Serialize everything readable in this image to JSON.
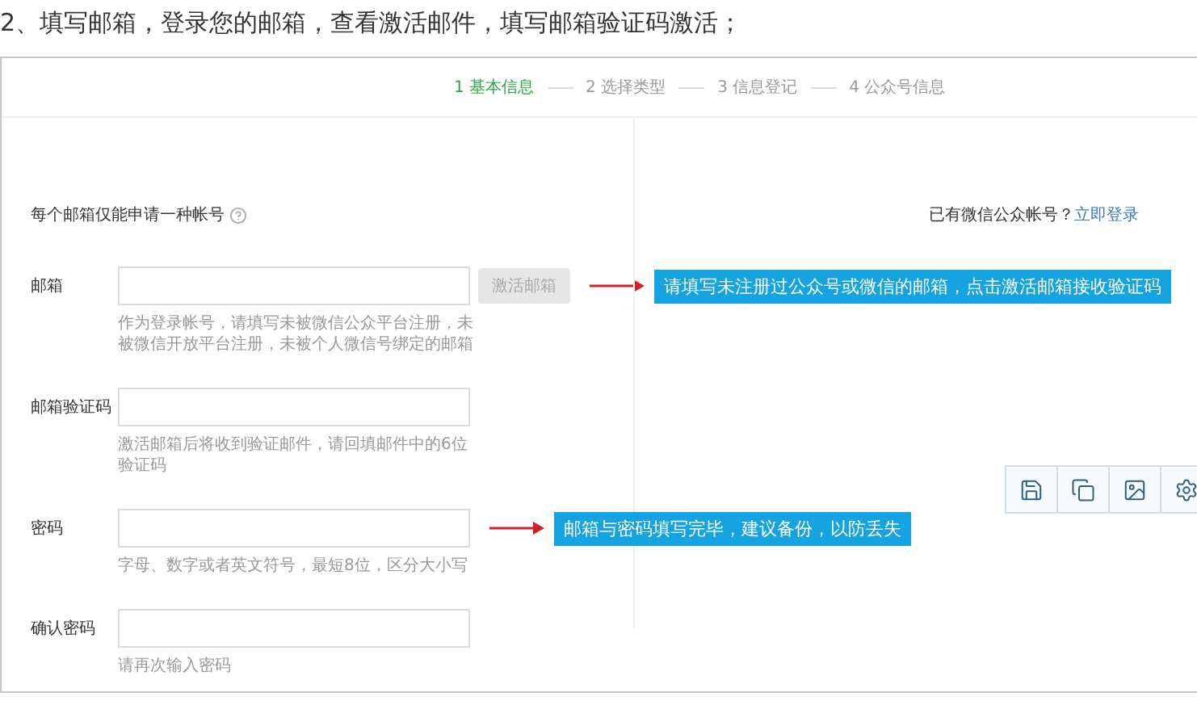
{
  "instruction": "2、填写邮箱，登录您的邮箱，查看激活邮件，填写邮箱验证码激活；",
  "steps": [
    {
      "label": "1 基本信息",
      "selected": true
    },
    {
      "label": "2 选择类型",
      "selected": false
    },
    {
      "label": "3 信息登记",
      "selected": false
    },
    {
      "label": "4 公众号信息",
      "selected": false
    }
  ],
  "notice": "每个邮箱仅能申请一种帐号",
  "login_prompt": {
    "text": "已有微信公众帐号？",
    "link": "立即登录"
  },
  "fields": [
    {
      "label": "邮箱",
      "hint": "作为登录帐号，请填写未被微信公众平台注册，未被微信开放平台注册，未被个人微信号绑定的邮箱",
      "button": {
        "label": "激活邮箱",
        "disabled": true
      },
      "callout": "请填写未注册过公众号或微信的邮箱，点击激活邮箱接收验证码"
    },
    {
      "label": "邮箱验证码",
      "hint": "激活邮箱后将收到验证邮件，请回填邮件中的6位验证码"
    },
    {
      "label": "密码",
      "hint": "字母、数字或者英文符号，最短8位，区分大小写",
      "callout": "邮箱与密码填写完毕，建议备份，以防丢失"
    },
    {
      "label": "确认密码",
      "hint": "请再次输入密码"
    }
  ],
  "toolbar": [
    {
      "kind": "save"
    },
    {
      "kind": "copy"
    },
    {
      "kind": "image"
    },
    {
      "kind": "settings"
    }
  ]
}
